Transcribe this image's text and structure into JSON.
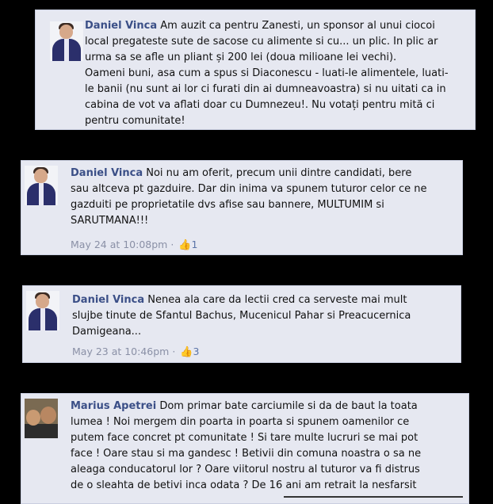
{
  "comments": [
    {
      "author": "Daniel Vinca",
      "body": "Am auzit ca pentru Zanesti, un sponsor al unui ciocoi\nlocal pregateste sute de sacose cu alimente si cu... un plic. In plic ar\nurma sa se afle un pliant și 200 lei (doua milioane lei vechi).\nOameni buni, asa cum a spus si Diaconescu - luati-le alimentele, luati-\nle banii (nu sunt ai lor ci furati din ai dumneavoastra) si nu uitati ca in\ncabina de vot va aflati doar cu Dumnezeu!. Nu votați pentru mită ci\npentru comunitate!"
    },
    {
      "author": "Daniel Vinca",
      "body": "Noi nu am oferit, precum unii dintre candidati, bere\nsau altceva pt gazduire. Dar din inima va spunem tuturor celor ce ne\ngazduiti pe proprietatile dvs afise sau bannere, MULTUMIM si\nSARUTMANA!!!",
      "timestamp": "May 24 at 10:08pm",
      "separator": "·",
      "likes": "1"
    },
    {
      "author": "Daniel Vinca",
      "body": "Nenea ala care da lectii cred ca serveste mai mult\nslujbe tinute de Sfantul Bachus, Mucenicul Pahar si Preacucernica\nDamigeana...",
      "timestamp": "May 23 at 10:46pm",
      "separator": "·",
      "likes": "3"
    },
    {
      "author": "Marius Apetrei",
      "body": "Dom primar bate carciumile si da de baut la toata\nlumea ! Noi mergem din poarta in poarta si spunem oamenilor ce\nputem face concret pt comunitate ! Si tare multe lucruri se mai pot\nface ! Oare stau si ma gandesc ! Betivii din comuna noastra o sa ne\naleaga conducatorul lor ? Oare viitorul nostru al tuturor va fi distrus\nde o sleahta de betivi inca odata ? De 16 ani am retrait la nesfarsit"
    }
  ],
  "icons": {
    "like": "thumbs-up-icon"
  },
  "colors": {
    "background": "#000000",
    "card": "#e6e8f1",
    "author": "#3b4f87",
    "meta": "#8a90a6",
    "like": "#5b74a8"
  }
}
